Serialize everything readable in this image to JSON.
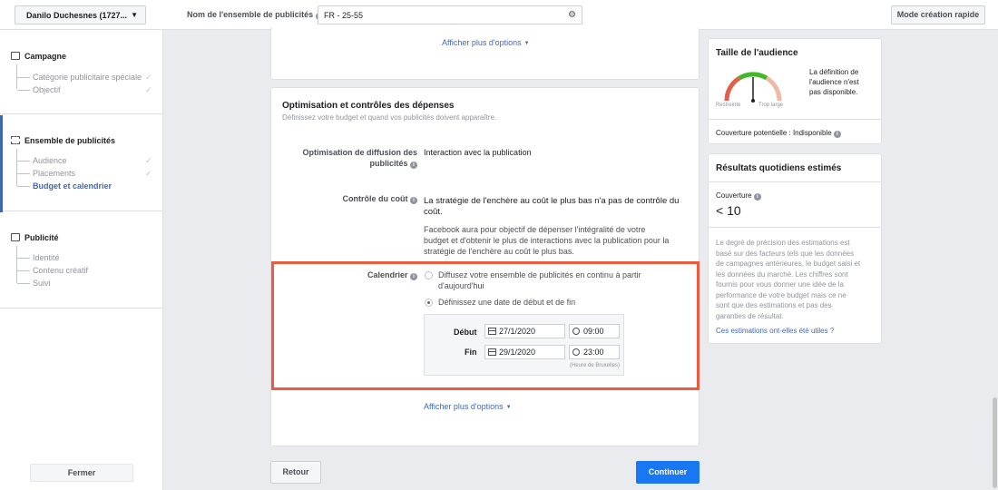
{
  "topbar": {
    "account": "Danilo Duchesnes (1727...",
    "adset_label": "Nom de l'ensemble de publicités",
    "adset_value": "FR - 25-55",
    "quick_button": "Mode création rapide"
  },
  "sidebar": {
    "campaign": {
      "title": "Campagne",
      "items": [
        "Catégorie publicitaire spéciale",
        "Objectif"
      ]
    },
    "adset": {
      "title": "Ensemble de publicités",
      "items": [
        "Audience",
        "Placements",
        "Budget et calendrier"
      ]
    },
    "ad": {
      "title": "Publicité",
      "items": [
        "Identité",
        "Contenu créatif",
        "Suivi"
      ]
    },
    "close_button": "Fermer"
  },
  "main": {
    "show_more_top": "Afficher plus d'options",
    "budget": {
      "title": "Optimisation et contrôles des dépenses",
      "subtitle": "Définissez votre budget et quand vos publicités doivent apparaître.",
      "optimization_label_1": "Optimisation de diffusion des",
      "optimization_label_2": "publicités",
      "optimization_value": "Interaction avec la publication",
      "cost_label": "Contrôle du coût",
      "cost_value_1": "La stratégie de l'enchère au coût le plus bas n'a pas de contrôle du",
      "cost_value_2": "coût.",
      "cost_desc_1": "Facebook aura pour objectif de dépenser l'intégralité de votre",
      "cost_desc_2": "budget et d'obtenir le plus de interactions avec la publication pour la",
      "cost_desc_3": "stratégie de l'enchère au coût le plus bas.",
      "schedule_label": "Calendrier",
      "option_continuous_1": "Diffusez votre ensemble de publicités en continu à partir",
      "option_continuous_2": "d'aujourd'hui",
      "option_dates": "Définissez une date de début et de fin",
      "start_label": "Début",
      "start_date": "27/1/2020",
      "start_time": "09:00",
      "end_label": "Fin",
      "end_date": "29/1/2020",
      "end_time": "23:00",
      "timezone": "(Heure de Bruxelles)",
      "show_more_bottom": "Afficher plus d'options"
    },
    "back_button": "Retour",
    "continue_button": "Continuer"
  },
  "right": {
    "audience": {
      "title": "Taille de l'audience",
      "desc_1": "La définition de",
      "desc_2": "l'audience n'est",
      "desc_3": "pas disponible.",
      "gauge_left": "Restreinte",
      "gauge_right": "Trop large",
      "coverage": "Couverture potentielle : Indisponible"
    },
    "daily": {
      "title": "Résultats quotidiens estimés",
      "coverage_label": "Couverture",
      "coverage_value": "< 10",
      "note": [
        "Le degré de précision des estimations est",
        "basé sur des facteurs tels que les données",
        "de campagnes antérieures, le budget saisi et",
        "les données du marché. Les chiffres sont",
        "fournis pour vous donner une idée de la",
        "performance de votre budget mais ce ne",
        "sont que des estimations et pas des",
        "garanties de résultat."
      ],
      "feedback_link": "Ces estimations ont-elles été utiles ?"
    }
  }
}
